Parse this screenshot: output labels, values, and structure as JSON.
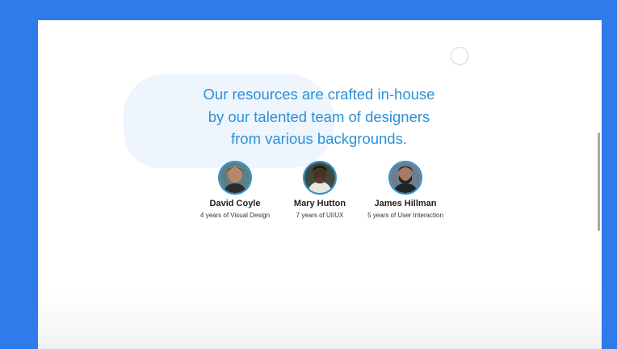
{
  "headline": {
    "line1": "Our resources are crafted in-house",
    "line2": "by our talented team of designers",
    "line3": "from various backgrounds."
  },
  "team": [
    {
      "name": "David Coyle",
      "role": "4 years of Visual Design",
      "avatar_icon": "person-portrait"
    },
    {
      "name": "Mary Hutton",
      "role": "7 years of UI/UX",
      "avatar_icon": "person-portrait"
    },
    {
      "name": "James Hillman",
      "role": "5 years of User Interaction",
      "avatar_icon": "person-portrait"
    }
  ],
  "colors": {
    "accent": "#2a90d8",
    "frame": "#2f7bea",
    "blob": "#eef5fd"
  }
}
